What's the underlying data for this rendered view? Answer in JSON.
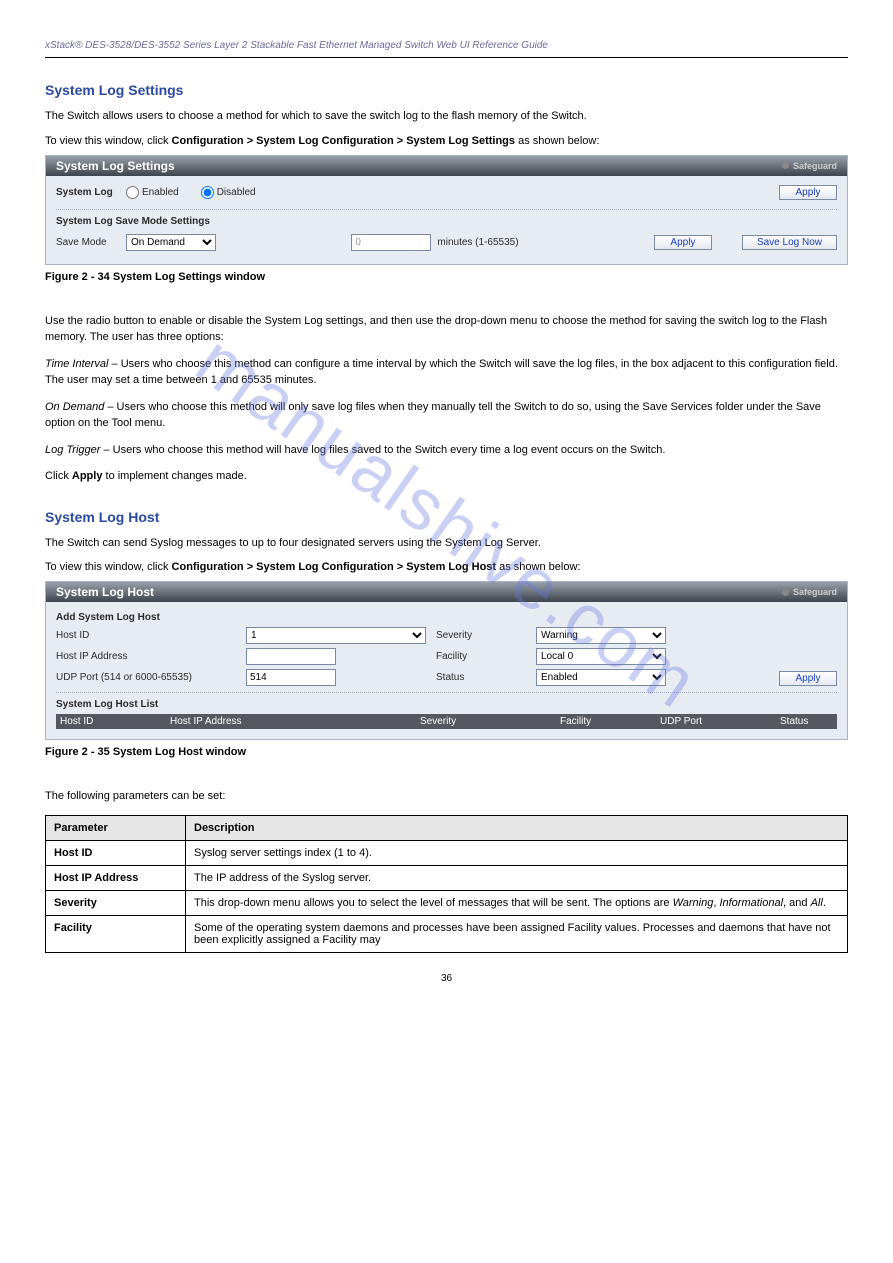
{
  "header": {
    "left": "xStack® DES-3528/DES-3552 Series Layer 2 Stackable Fast Ethernet Managed Switch Web UI Reference Guide",
    "right": ""
  },
  "watermark": "manualshive.com",
  "settings_section": {
    "title": "System Log Settings",
    "intro_1": "The Switch allows users to choose a method for which to save the switch log to the flash memory of the Switch.",
    "nav_label": "To view this window, click ",
    "nav_path": "Configuration > System Log Configuration > System Log Settings",
    "nav_suffix": " as shown below:",
    "panel": {
      "title": "System Log Settings",
      "safeguard": "Safeguard",
      "syslog_label": "System Log",
      "enabled": "Enabled",
      "disabled": "Disabled",
      "apply1": "Apply",
      "subhead": "System Log Save Mode Settings",
      "savemode_label": "Save Mode",
      "savemode_value": "On Demand",
      "minutes_value": "0",
      "minutes_label": "minutes (1-65535)",
      "apply2": "Apply",
      "savenow": "Save Log Now"
    },
    "figcap": "Figure 2 - 34 System Log Settings window",
    "para1": "Use the radio button to enable or disable the System Log settings, and then use the drop-down menu to choose the method for saving the switch log to the Flash memory. The user has three options:",
    "para2_label": "Time Interval",
    "para2_text": " – Users who choose this method can configure a time interval by which the Switch will save the log files, in the box adjacent to this configuration field. The user may set a time between 1 and 65535 minutes.",
    "para3_label": "On Demand",
    "para3_text": " – Users who choose this method will only save log files when they manually tell the Switch to do so, using the Save Services folder under the Save option on the Tool menu.",
    "para4_label": "Log Trigger",
    "para4_text": " – Users who choose this method will have log files saved to the Switch every time a log event occurs on the Switch.",
    "para5_prefix": "Click ",
    "para5_bold": "Apply",
    "para5_suffix": " to implement changes made."
  },
  "host_section": {
    "title": "System Log Host",
    "intro": "The Switch can send Syslog messages to up to four designated servers using the System Log Server.",
    "nav_label": "To view this window, click ",
    "nav_path": "Configuration > System Log Configuration > System Log Host",
    "nav_suffix": " as shown below:",
    "panel": {
      "title": "System Log Host",
      "safeguard": "Safeguard",
      "subhead": "Add System Log Host",
      "hostid_label": "Host ID",
      "hostid_value": "1",
      "hostip_label": "Host IP Address",
      "hostip_value": "",
      "udp_label": "UDP Port (514 or 6000-65535)",
      "udp_value": "514",
      "severity_label": "Severity",
      "severity_value": "Warning",
      "facility_label": "Facility",
      "facility_value": "Local 0",
      "status_label": "Status",
      "status_value": "Enabled",
      "apply": "Apply",
      "list_head": "System Log Host List",
      "cols": {
        "c1": "Host ID",
        "c2": "Host IP Address",
        "c3": "Severity",
        "c4": "Facility",
        "c5": "UDP Port",
        "c6": "Status"
      }
    },
    "figcap": "Figure 2 - 35 System Log Host window",
    "table_intro": "The following parameters can be set:",
    "table": {
      "head_param": "Parameter",
      "head_desc": "Description",
      "r1p": "Host ID",
      "r1d": "Syslog server settings index (1 to 4).",
      "r2p": "Host IP Address",
      "r2d": "The IP address of the Syslog server.",
      "r3p": "Severity",
      "r3d_1": "This drop-down menu allows you to select the level of messages that will be sent. The options are ",
      "r3d_2": "Warning",
      "r3d_3": ", ",
      "r3d_4": "Informational",
      "r3d_5": ", and ",
      "r3d_6": "All",
      "r3d_7": ".",
      "r4p": "Facility",
      "r4d": "Some of the operating system daemons and processes have been assigned Facility values. Processes and daemons that have not been explicitly assigned a Facility may"
    }
  },
  "footer": "36"
}
